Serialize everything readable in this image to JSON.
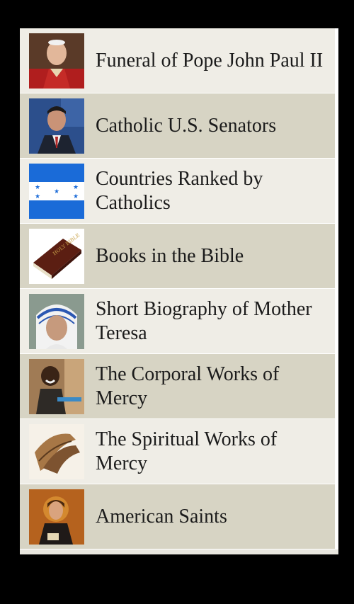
{
  "items": [
    {
      "label": "Funeral of Pope John Paul II",
      "icon": "pope-portrait-icon"
    },
    {
      "label": "Catholic U.S. Senators",
      "icon": "senator-portrait-icon"
    },
    {
      "label": "Countries Ranked by Catholics",
      "icon": "honduras-flag-icon"
    },
    {
      "label": "Books in the Bible",
      "icon": "bible-book-icon"
    },
    {
      "label": "Short Biography of Mother Teresa",
      "icon": "mother-teresa-portrait-icon"
    },
    {
      "label": "The Corporal Works of Mercy",
      "icon": "child-photo-icon"
    },
    {
      "label": "The Spiritual Works of Mercy",
      "icon": "praying-hands-icon"
    },
    {
      "label": "American Saints",
      "icon": "saint-painting-icon"
    }
  ],
  "colors": {
    "row_light": "#efede6",
    "row_dark": "#d7d4c4",
    "background": "#000000",
    "flag_blue": "#1a6bd8"
  }
}
